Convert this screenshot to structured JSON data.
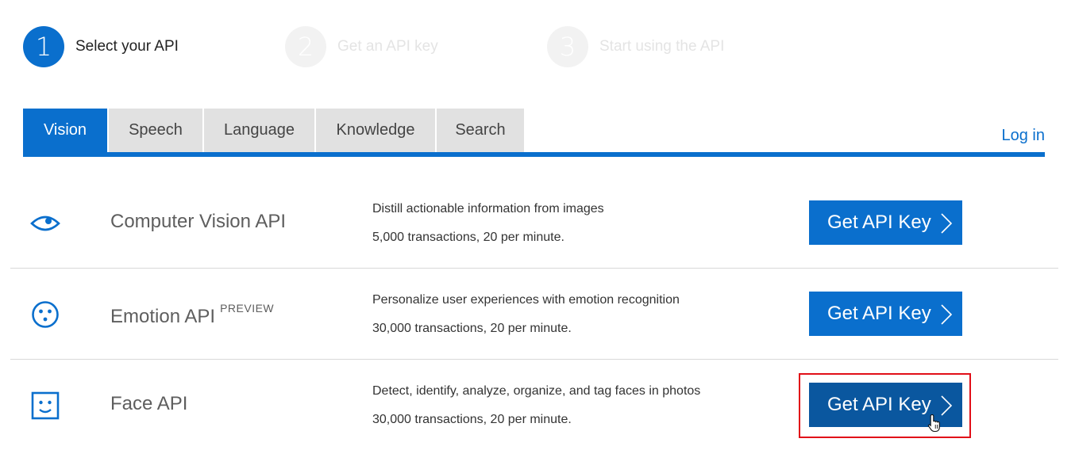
{
  "steps": [
    {
      "num": "1",
      "label": "Select your API",
      "state": "active"
    },
    {
      "num": "2",
      "label": "Get an API key",
      "state": "inactive"
    },
    {
      "num": "3",
      "label": "Start using the API",
      "state": "inactive"
    }
  ],
  "tabs": [
    {
      "label": "Vision",
      "active": true
    },
    {
      "label": "Speech",
      "active": false
    },
    {
      "label": "Language",
      "active": false
    },
    {
      "label": "Knowledge",
      "active": false
    },
    {
      "label": "Search",
      "active": false
    }
  ],
  "login_label": "Log in",
  "apis": [
    {
      "icon": "eye-icon",
      "name": "Computer Vision API",
      "badge": "",
      "description": "Distill actionable information from images",
      "quota": "5,000 transactions, 20 per minute.",
      "button_label": "Get API Key"
    },
    {
      "icon": "emotion-face-icon",
      "name": "Emotion API",
      "badge": "PREVIEW",
      "description": "Personalize user experiences with emotion recognition",
      "quota": "30,000 transactions, 20 per minute.",
      "button_label": "Get API Key"
    },
    {
      "icon": "face-icon",
      "name": "Face API",
      "badge": "",
      "description": "Detect, identify, analyze, organize, and tag faces in photos",
      "quota": "30,000 transactions, 20 per minute.",
      "button_label": "Get API Key"
    }
  ],
  "colors": {
    "accent": "#0a6fcd",
    "pressed": "#0a579f",
    "highlight": "#e10e18"
  }
}
